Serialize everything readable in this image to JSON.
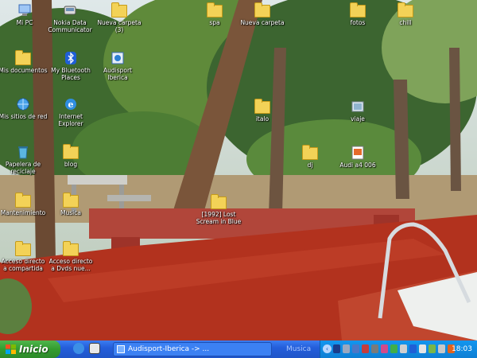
{
  "desktop": {
    "icons": [
      {
        "label": "Mi PC",
        "kind": "pc"
      },
      {
        "label": "Nokia Data\nCommunicator",
        "kind": "app"
      },
      {
        "label": "Nueva carpeta\n(3)",
        "kind": "folder"
      },
      {
        "label": "Mis documentos",
        "kind": "folder"
      },
      {
        "label": "My Bluetooth\nPlaces",
        "kind": "bluetooth"
      },
      {
        "label": "Audisport\nIberica",
        "kind": "shortcut"
      },
      {
        "label": "Mis sitios de red",
        "kind": "network"
      },
      {
        "label": "Internet\nExplorer",
        "kind": "ie"
      },
      {
        "label": "Papelera de\nreciclaje",
        "kind": "recycle"
      },
      {
        "label": "blog",
        "kind": "folder"
      },
      {
        "label": "Mantenimiento",
        "kind": "folder"
      },
      {
        "label": "Musica",
        "kind": "folder"
      },
      {
        "label": "Acceso directo\na compartida",
        "kind": "folder"
      },
      {
        "label": "Acceso directo\na Dvds nue...",
        "kind": "folder"
      },
      {
        "label": "spa",
        "kind": "folder"
      },
      {
        "label": "Nueva carpeta",
        "kind": "folder"
      },
      {
        "label": "fotos",
        "kind": "folder"
      },
      {
        "label": "chill",
        "kind": "folder"
      },
      {
        "label": "italo",
        "kind": "folder"
      },
      {
        "label": "viaje",
        "kind": "image"
      },
      {
        "label": "dj",
        "kind": "folder"
      },
      {
        "label": "Audi a4 006",
        "kind": "photo"
      },
      {
        "label": "[1992] Lost\nScream in Blue",
        "kind": "folder"
      }
    ]
  },
  "taskbar": {
    "start_label": "Inicio",
    "task_button": "Audisport-Iberica -> ...",
    "toolbar_label": "Musica",
    "clock": "18:03"
  },
  "colors": {
    "taskbar_blue": "#245edb",
    "start_green": "#339c2f",
    "tray_blue": "#0e7fd4",
    "folder_yellow": "#f3d257"
  }
}
